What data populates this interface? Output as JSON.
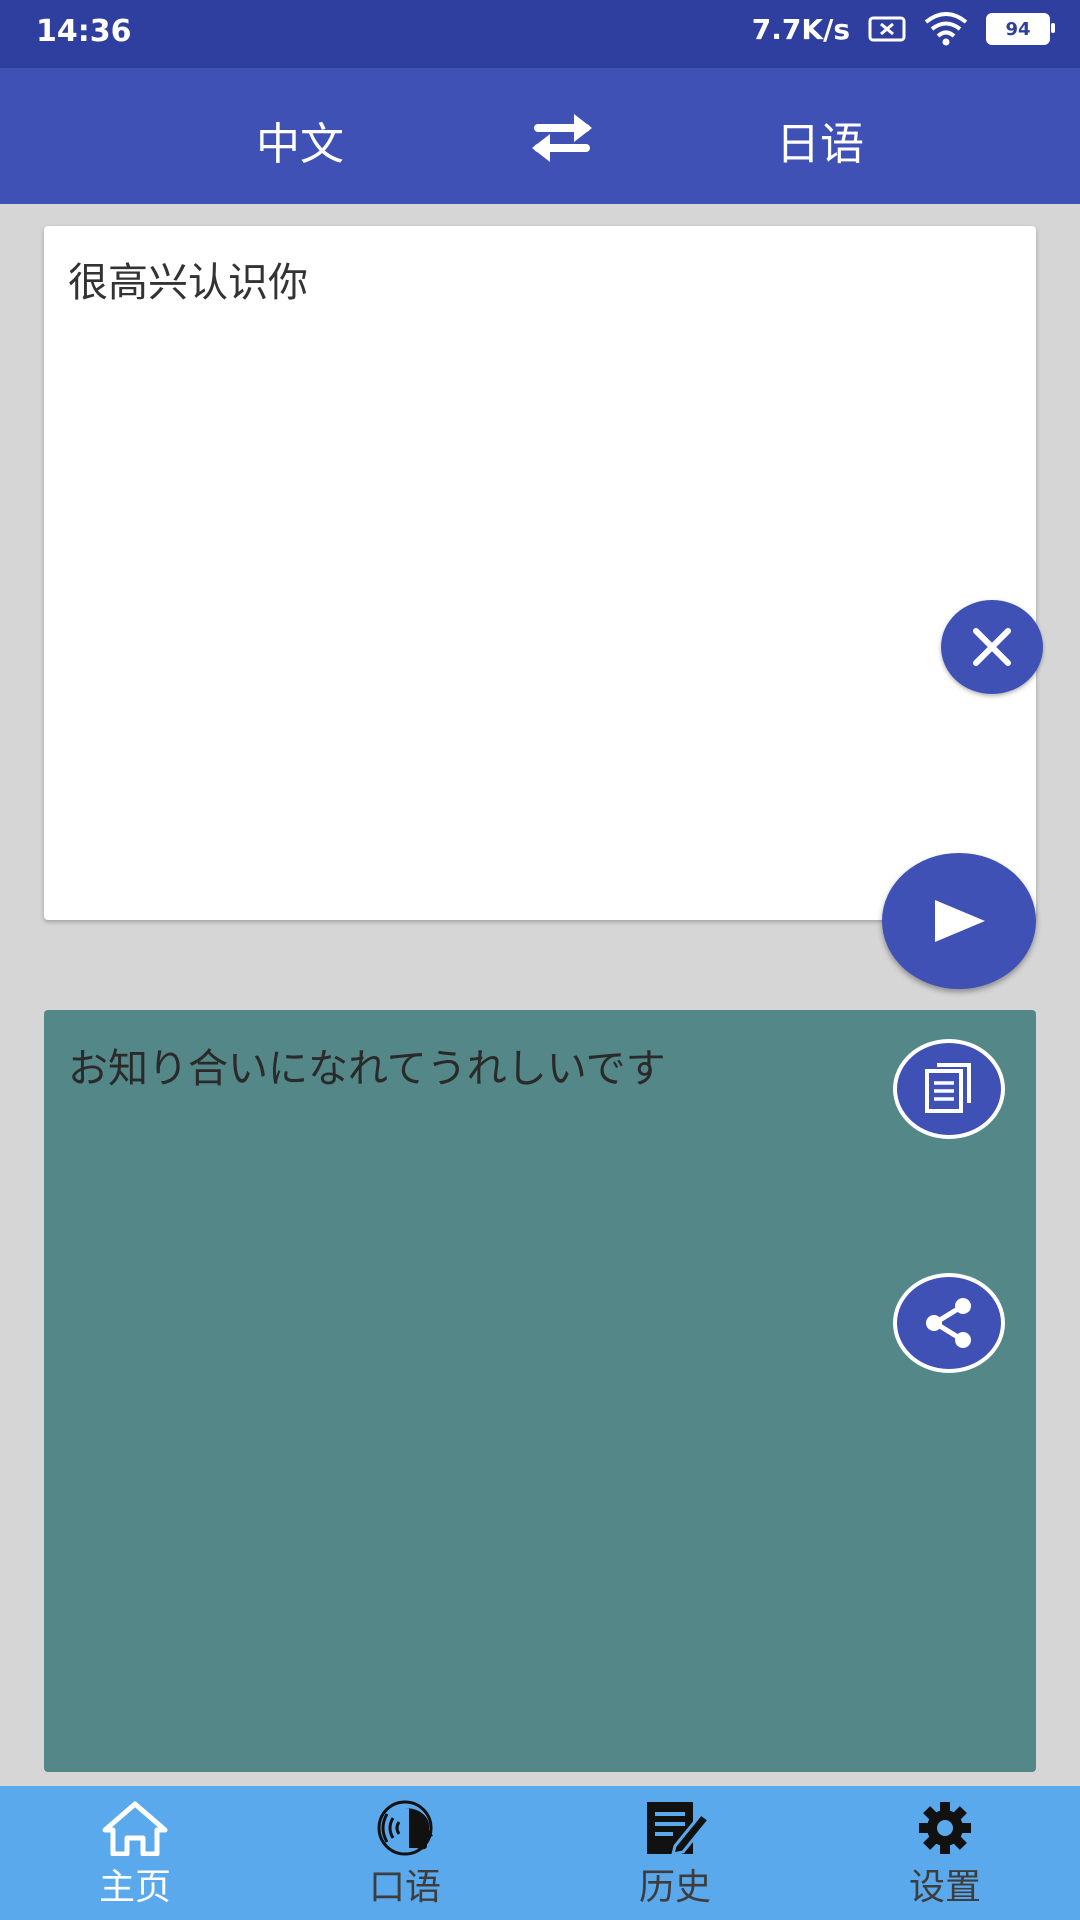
{
  "status_bar": {
    "time": "14:36",
    "net_speed": "7.7K/s",
    "battery": "94"
  },
  "header": {
    "source_lang": "中文",
    "target_lang": "日语"
  },
  "input": {
    "text": "很高兴认识你"
  },
  "output": {
    "text": "お知り合いになれてうれしいです"
  },
  "bottom_nav": {
    "items": [
      {
        "label": "主页",
        "icon": "home-icon",
        "active": true
      },
      {
        "label": "口语",
        "icon": "speak-icon",
        "active": false
      },
      {
        "label": "历史",
        "icon": "history-icon",
        "active": false
      },
      {
        "label": "设置",
        "icon": "gear-icon",
        "active": false
      }
    ]
  },
  "colors": {
    "status_bar": "#2f3fa0",
    "app_bar": "#3f51b5",
    "output_bg": "#548788",
    "bottom_nav": "#5aa9ec",
    "page_bg": "#d6d6d6"
  }
}
